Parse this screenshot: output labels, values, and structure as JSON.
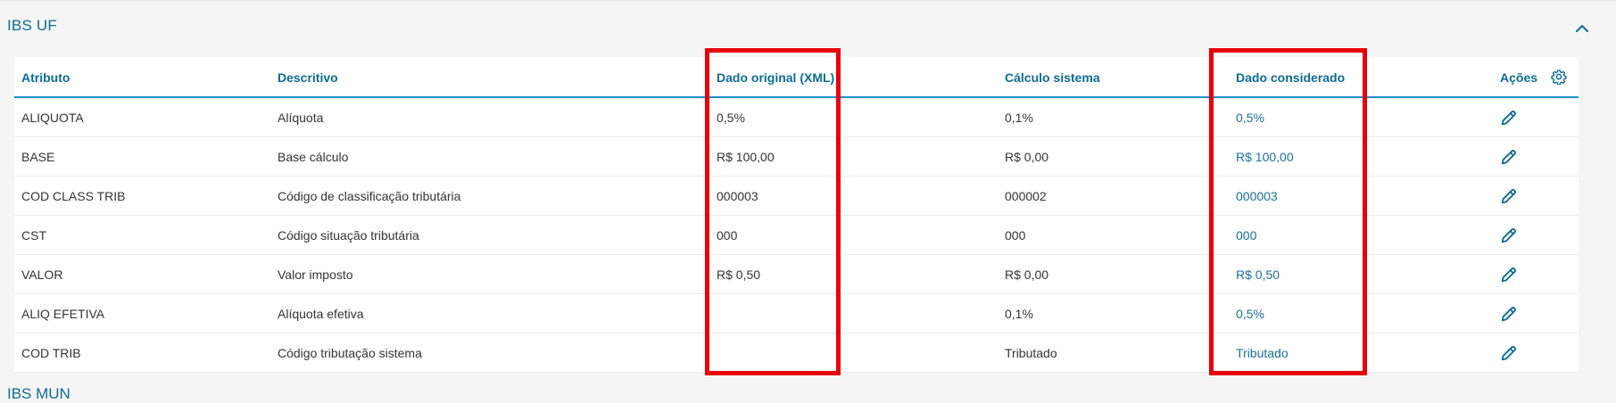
{
  "section": {
    "title": "IBS UF"
  },
  "next_section": {
    "title": "IBS MUN"
  },
  "table": {
    "headers": {
      "atributo": "Atributo",
      "descritivo": "Descritivo",
      "original": "Dado original (XML)",
      "calculo": "Cálculo sistema",
      "considerado": "Dado considerado",
      "acoes": "Ações"
    },
    "rows": [
      {
        "atributo": "ALIQUOTA",
        "descritivo": "Alíquota",
        "original": "0,5%",
        "calculo": "0,1%",
        "considerado": "0,5%"
      },
      {
        "atributo": "BASE",
        "descritivo": "Base cálculo",
        "original": "R$ 100,00",
        "calculo": "R$ 0,00",
        "considerado": "R$ 100,00"
      },
      {
        "atributo": "COD CLASS TRIB",
        "descritivo": "Código de classificação tributária",
        "original": "000003",
        "calculo": "000002",
        "considerado": "000003"
      },
      {
        "atributo": "CST",
        "descritivo": "Código situação tributária",
        "original": "000",
        "calculo": "000",
        "considerado": "000"
      },
      {
        "atributo": "VALOR",
        "descritivo": "Valor imposto",
        "original": "R$ 0,50",
        "calculo": "R$ 0,00",
        "considerado": "R$ 0,50"
      },
      {
        "atributo": "ALIQ EFETIVA",
        "descritivo": "Alíquota efetiva",
        "original": "",
        "calculo": "0,1%",
        "considerado": "0,5%"
      },
      {
        "atributo": "COD TRIB",
        "descritivo": "Código tributação sistema",
        "original": "",
        "calculo": "Tributado",
        "considerado": "Tributado"
      }
    ]
  },
  "icons": {
    "collapse": "chevron-up-icon",
    "settings": "gear-icon",
    "edit": "pencil-icon"
  },
  "colors": {
    "accent": "#0c6c94",
    "header_rule": "#1d8fc7",
    "highlight": "#e8000d"
  }
}
